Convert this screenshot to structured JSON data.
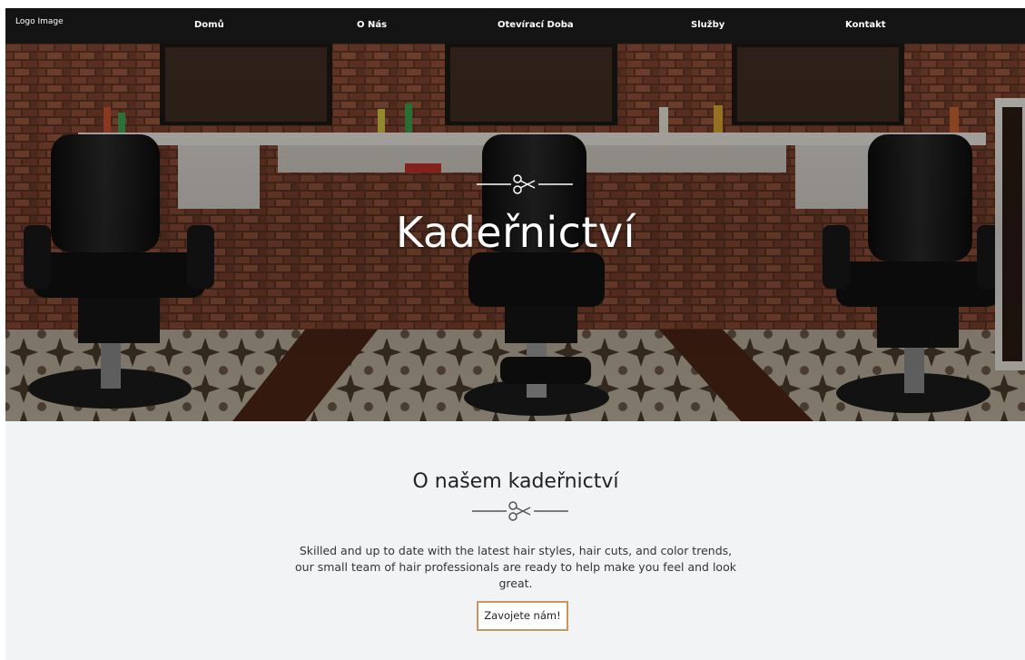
{
  "navbar": {
    "logo": "Logo Image",
    "items": [
      {
        "label": "Domů"
      },
      {
        "label": "O Nás"
      },
      {
        "label": "Otevírací Doba"
      },
      {
        "label": "Služby"
      },
      {
        "label": "Kontakt"
      }
    ]
  },
  "hero": {
    "title": "Kadeřnictví",
    "ornament_icon": "scissors-icon"
  },
  "about": {
    "title": "O našem kadeřnictví",
    "ornament_icon": "scissors-icon",
    "text": "Skilled and up to date with the latest hair styles, hair cuts, and color trends, our small team of hair professionals are ready to help make you feel and look great.",
    "cta_label": "Zavojete nám!"
  },
  "colors": {
    "navbar_bg": "#141414",
    "page_bg": "#f2f3f4",
    "cta_border": "#c8955c"
  }
}
